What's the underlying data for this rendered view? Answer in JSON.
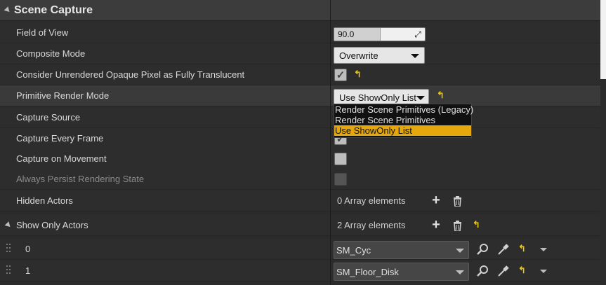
{
  "section": {
    "title": "Scene Capture"
  },
  "properties": {
    "field_of_view": {
      "label": "Field of View",
      "value": "90.0",
      "fraction": 0.5
    },
    "composite_mode": {
      "label": "Composite Mode",
      "value": "Overwrite"
    },
    "consider_unrendered": {
      "label": "Consider Unrendered Opaque Pixel as Fully Translucent",
      "checked": true,
      "reset_icon": "reset-arrow-icon"
    },
    "primitive_render_mode": {
      "label": "Primitive Render Mode",
      "value": "Use ShowOnly List",
      "reset_icon": "reset-arrow-icon"
    },
    "capture_source": {
      "label": "Capture Source"
    },
    "capture_every_frame": {
      "label": "Capture Every Frame",
      "checked": true
    },
    "capture_on_movement": {
      "label": "Capture on Movement",
      "checked": false
    },
    "always_persist": {
      "label": "Always Persist Rendering State",
      "checked": false,
      "disabled": true
    },
    "hidden_actors": {
      "label": "Hidden Actors",
      "count_text": "0 Array elements"
    },
    "show_only_actors": {
      "label": "Show Only Actors",
      "count_text": "2 Array elements",
      "elements": [
        {
          "index": "0",
          "asset": "SM_Cyc"
        },
        {
          "index": "1",
          "asset": "SM_Floor_Disk"
        }
      ]
    }
  },
  "dropdown": {
    "options": [
      "Render Scene Primitives (Legacy)",
      "Render Scene Primitives",
      "Use ShowOnly List"
    ],
    "selected_index": 2,
    "selected_color": "#e5a70b"
  },
  "colors": {
    "reset_arrow": "#e6c619",
    "background": "#2b2b2b"
  }
}
